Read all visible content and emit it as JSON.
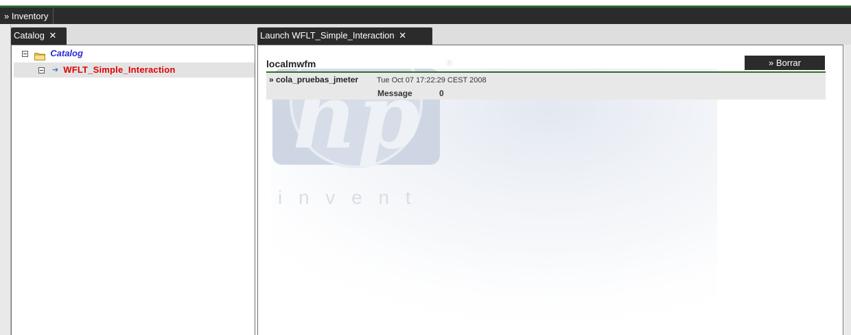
{
  "menu": {
    "inventory_label": "» Inventory"
  },
  "tabs": [
    {
      "label": "Catalog",
      "close_glyph": "✕"
    },
    {
      "label": "Launch WFLT_Simple_Interaction",
      "close_glyph": "✕"
    }
  ],
  "tree": {
    "root": {
      "label": "Catalog",
      "icon": "folder-icon"
    },
    "children": [
      {
        "label": "WFLT_Simple_Interaction",
        "icon": "arrow-icon"
      }
    ]
  },
  "launch": {
    "host_title": "localmwfm",
    "borrar_label": "» Borrar",
    "queue": {
      "name": "» cola_pruebas_jmeter",
      "timestamp": "Tue Oct 07 17:22:29 CEST 2008",
      "message_label": "Message",
      "message_count": "0"
    }
  },
  "watermark": {
    "text": "i n v e n t",
    "registered_mark": "®"
  },
  "colors": {
    "accent_green": "#2e6b2e",
    "bar_dark": "#2b2b2b",
    "catalog_link": "#2a2ad0",
    "workflow_red": "#e00000"
  }
}
